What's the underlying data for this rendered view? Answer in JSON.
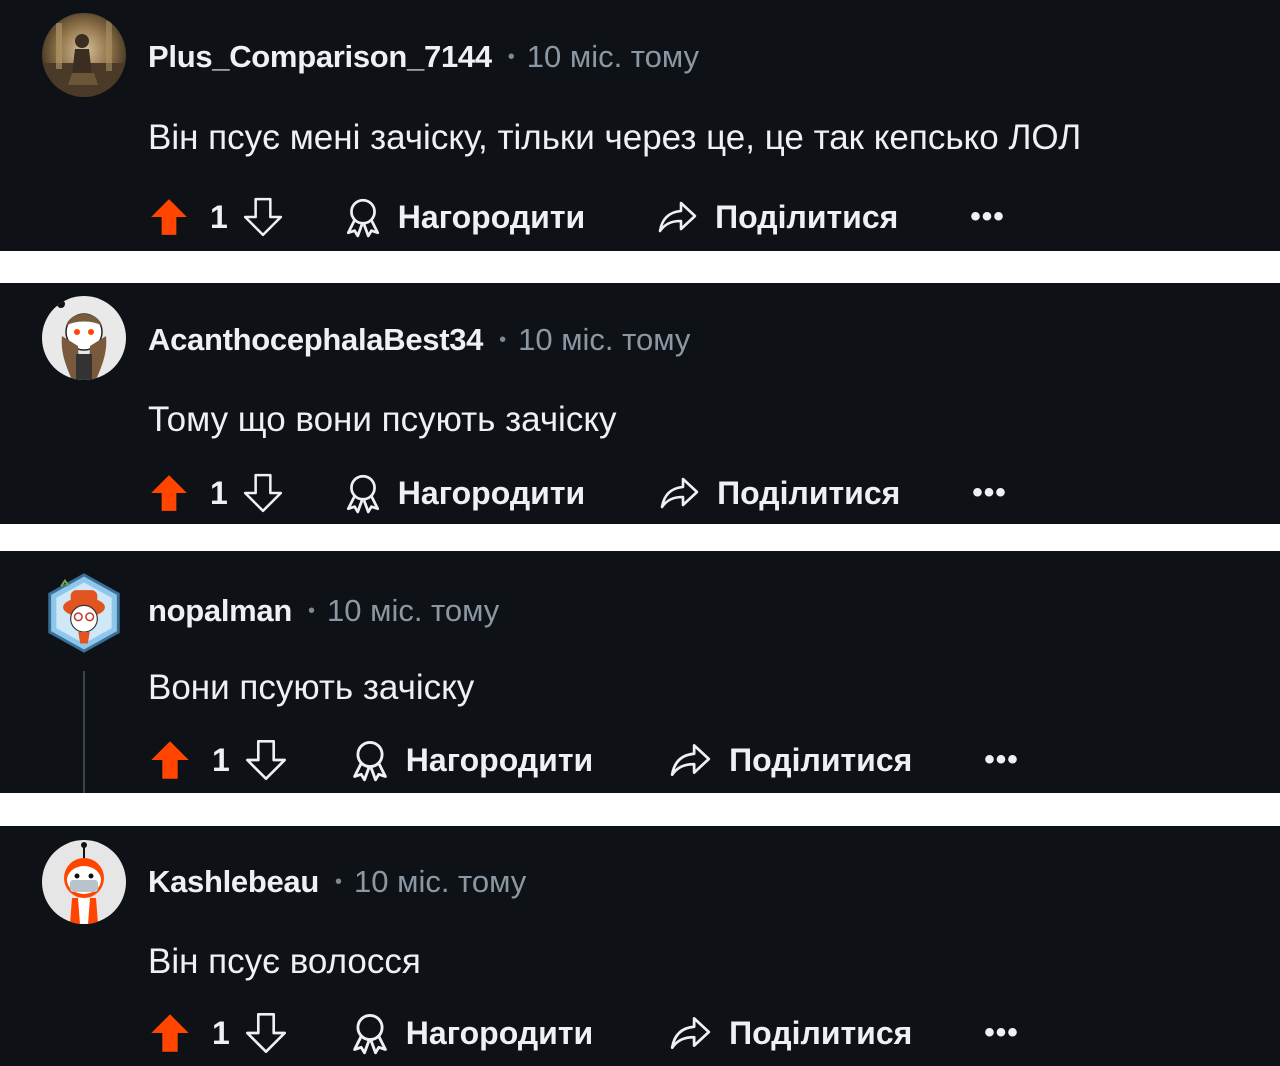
{
  "comments": [
    {
      "username": "Plus_Comparison_7144",
      "separator": "•",
      "time": "10 міс. тому",
      "text": "Він псує мені зачіску, тільки через це, це так кепсько ЛОЛ",
      "score": "1",
      "award_label": "Нагородити",
      "share_label": "Поділитися",
      "more_label": "•••"
    },
    {
      "username": "AcanthocephalaBest34",
      "separator": "•",
      "time": "10 міс. тому",
      "text": "Тому що вони псують зачіску",
      "score": "1",
      "award_label": "Нагородити",
      "share_label": "Поділитися",
      "more_label": "•••"
    },
    {
      "username": "nopalman",
      "separator": "•",
      "time": "10 міс. тому",
      "text": "Вони псують зачіску",
      "score": "1",
      "award_label": "Нагородити",
      "share_label": "Поділитися",
      "more_label": "•••"
    },
    {
      "username": "Kashlebeau",
      "separator": "•",
      "time": "10 міс. тому",
      "text": "Він псує волосся",
      "score": "1",
      "award_label": "Нагородити",
      "share_label": "Поділитися",
      "more_label": "•••"
    }
  ],
  "colors": {
    "background": "#0e1217",
    "upvote_active": "#ff4500",
    "text_primary": "#eef1f3",
    "text_secondary": "#8b97a2",
    "separator_bg": "#ffffff"
  },
  "icons": {
    "upvote": "arrow-up-filled-icon",
    "downvote": "arrow-down-outline-icon",
    "award": "award-ribbon-icon",
    "share": "share-arrow-icon",
    "more": "more-dots-icon"
  }
}
